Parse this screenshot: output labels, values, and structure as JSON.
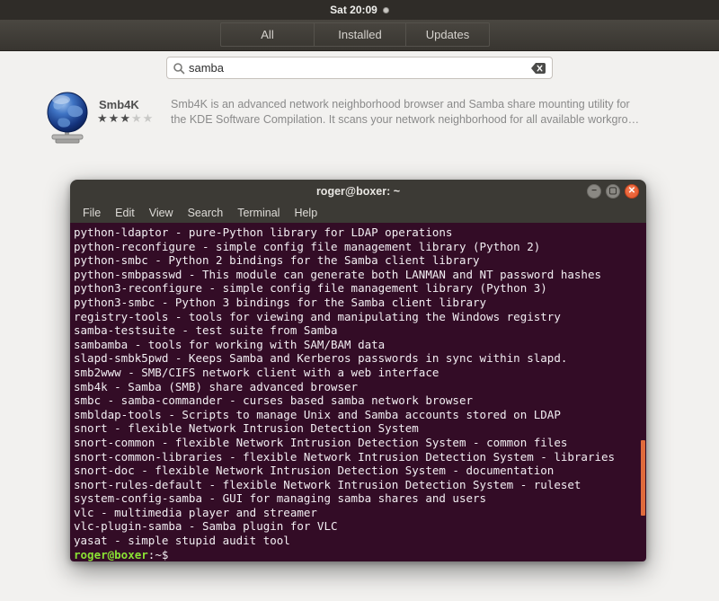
{
  "colors": {
    "main-bg": "#f2f1ef",
    "topbar-bg": "#2f2c28",
    "chrome-bg": "#3c3a35",
    "terminal-bg": "#330c26",
    "prompt-green": "#8ae234",
    "scrollbar-orange": "#e06b3c",
    "close-orange": "#e4572b"
  },
  "top_bar": {
    "clock": "Sat 20:09"
  },
  "header": {
    "tabs": [
      {
        "label": "All",
        "width": 103
      },
      {
        "label": "Installed",
        "width": 102
      },
      {
        "label": "Updates",
        "width": 93
      }
    ]
  },
  "search": {
    "value": "samba",
    "placeholder": ""
  },
  "result": {
    "name": "Smb4K",
    "rating_filled": 3,
    "rating_total": 5,
    "description_line1": "Smb4K is an advanced network neighborhood browser and Samba share mounting utility for",
    "description_line2": "the KDE Software Compilation. It scans your network neighborhood for all available workgro…"
  },
  "terminal": {
    "title": "roger@boxer: ~",
    "menu": [
      "File",
      "Edit",
      "View",
      "Search",
      "Terminal",
      "Help"
    ],
    "lines": [
      "python-ldaptor - pure-Python library for LDAP operations",
      "python-reconfigure - simple config file management library (Python 2)",
      "python-smbc - Python 2 bindings for the Samba client library",
      "python-smbpasswd - This module can generate both LANMAN and NT password hashes",
      "python3-reconfigure - simple config file management library (Python 3)",
      "python3-smbc - Python 3 bindings for the Samba client library",
      "registry-tools - tools for viewing and manipulating the Windows registry",
      "samba-testsuite - test suite from Samba",
      "sambamba - tools for working with SAM/BAM data",
      "slapd-smbk5pwd - Keeps Samba and Kerberos passwords in sync within slapd.",
      "smb2www - SMB/CIFS network client with a web interface",
      "smb4k - Samba (SMB) share advanced browser",
      "smbc - samba-commander - curses based samba network browser",
      "smbldap-tools - Scripts to manage Unix and Samba accounts stored on LDAP",
      "snort - flexible Network Intrusion Detection System",
      "snort-common - flexible Network Intrusion Detection System - common files",
      "snort-common-libraries - flexible Network Intrusion Detection System - libraries",
      "snort-doc - flexible Network Intrusion Detection System - documentation",
      "snort-rules-default - flexible Network Intrusion Detection System - ruleset",
      "system-config-samba - GUI for managing samba shares and users",
      "vlc - multimedia player and streamer",
      "vlc-plugin-samba - Samba plugin for VLC",
      "yasat - simple stupid audit tool"
    ],
    "prompt": {
      "user_host": "roger@boxer",
      "rest": ":~$ "
    }
  }
}
